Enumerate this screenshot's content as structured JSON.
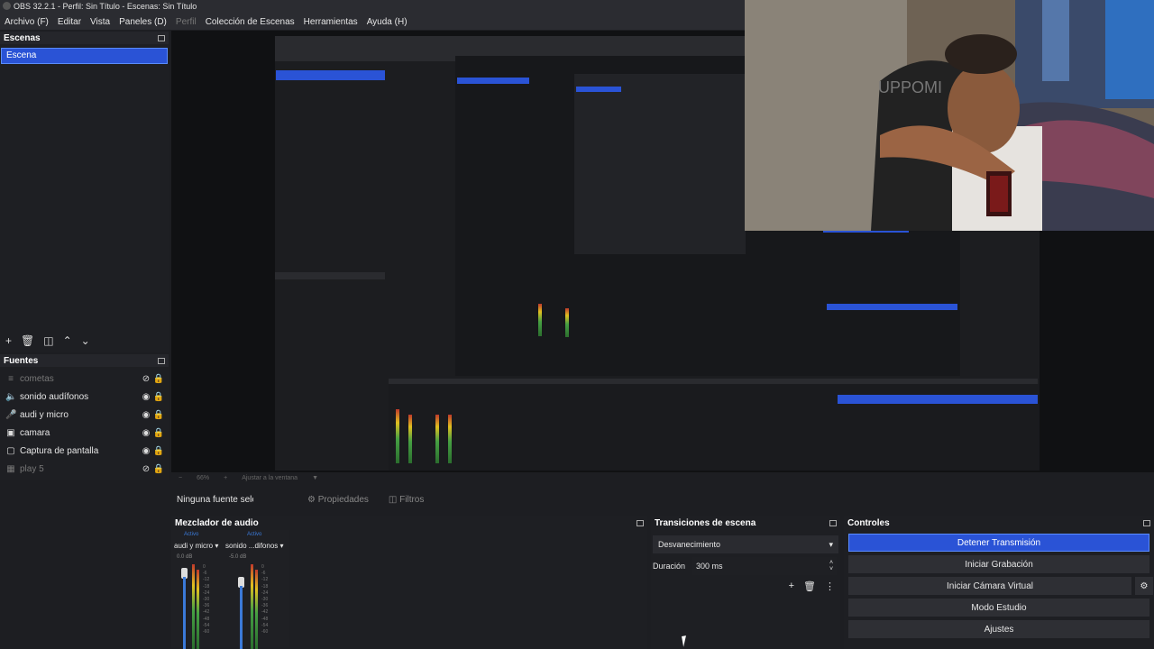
{
  "window": {
    "title": "OBS 32.2.1 - Perfil: Sin Título - Escenas: Sin Título"
  },
  "menu": [
    {
      "label": "Archivo (F)",
      "enabled": true
    },
    {
      "label": "Editar",
      "enabled": true
    },
    {
      "label": "Vista",
      "enabled": true
    },
    {
      "label": "Paneles (D)",
      "enabled": true
    },
    {
      "label": "Perfil",
      "enabled": false
    },
    {
      "label": "Colección de Escenas",
      "enabled": true
    },
    {
      "label": "Herramientas",
      "enabled": true
    },
    {
      "label": "Ayuda (H)",
      "enabled": true
    }
  ],
  "scenes": {
    "title": "Escenas",
    "items": [
      "Escena"
    ]
  },
  "sources": {
    "title": "Fuentes",
    "items": [
      {
        "label": "cometas",
        "icon": "text-icon",
        "visible": false
      },
      {
        "label": "sonido audífonos",
        "icon": "speaker-icon",
        "visible": true
      },
      {
        "label": "audi y micro",
        "icon": "mic-icon",
        "visible": true
      },
      {
        "label": "camara",
        "icon": "camera-icon",
        "visible": true
      },
      {
        "label": "Captura de pantalla",
        "icon": "monitor-icon",
        "visible": true
      },
      {
        "label": "play 5",
        "icon": "image-icon",
        "visible": false
      }
    ]
  },
  "preview": {
    "zoom": "66%",
    "fit": "Ajustar a la ventana"
  },
  "properties_bar": {
    "no_selection": "Ninguna fuente seleccionada",
    "properties": "Propiedades",
    "filters": "Filtros"
  },
  "mixer": {
    "title": "Mezclador de audio",
    "channels": [
      {
        "name": "audi y micro",
        "status": "Activo",
        "db": "0.0 dB"
      },
      {
        "name": "sonido ...difonos",
        "status": "Activo",
        "db": "-5.0 dB"
      }
    ],
    "scale": [
      "0",
      "-6",
      "-12",
      "-18",
      "-24",
      "-30",
      "-36",
      "-42",
      "-48",
      "-54",
      "-60"
    ]
  },
  "transitions": {
    "title": "Transiciones de escena",
    "selected": "Desvanecimiento",
    "duration_label": "Duración",
    "duration_value": "300 ms"
  },
  "controls": {
    "title": "Controles",
    "buttons": [
      "Detener Transmisión",
      "Iniciar Grabación",
      "Iniciar Cámara Virtual",
      "Modo Estudio",
      "Ajustes"
    ]
  },
  "accent_color": "#2a53d6"
}
